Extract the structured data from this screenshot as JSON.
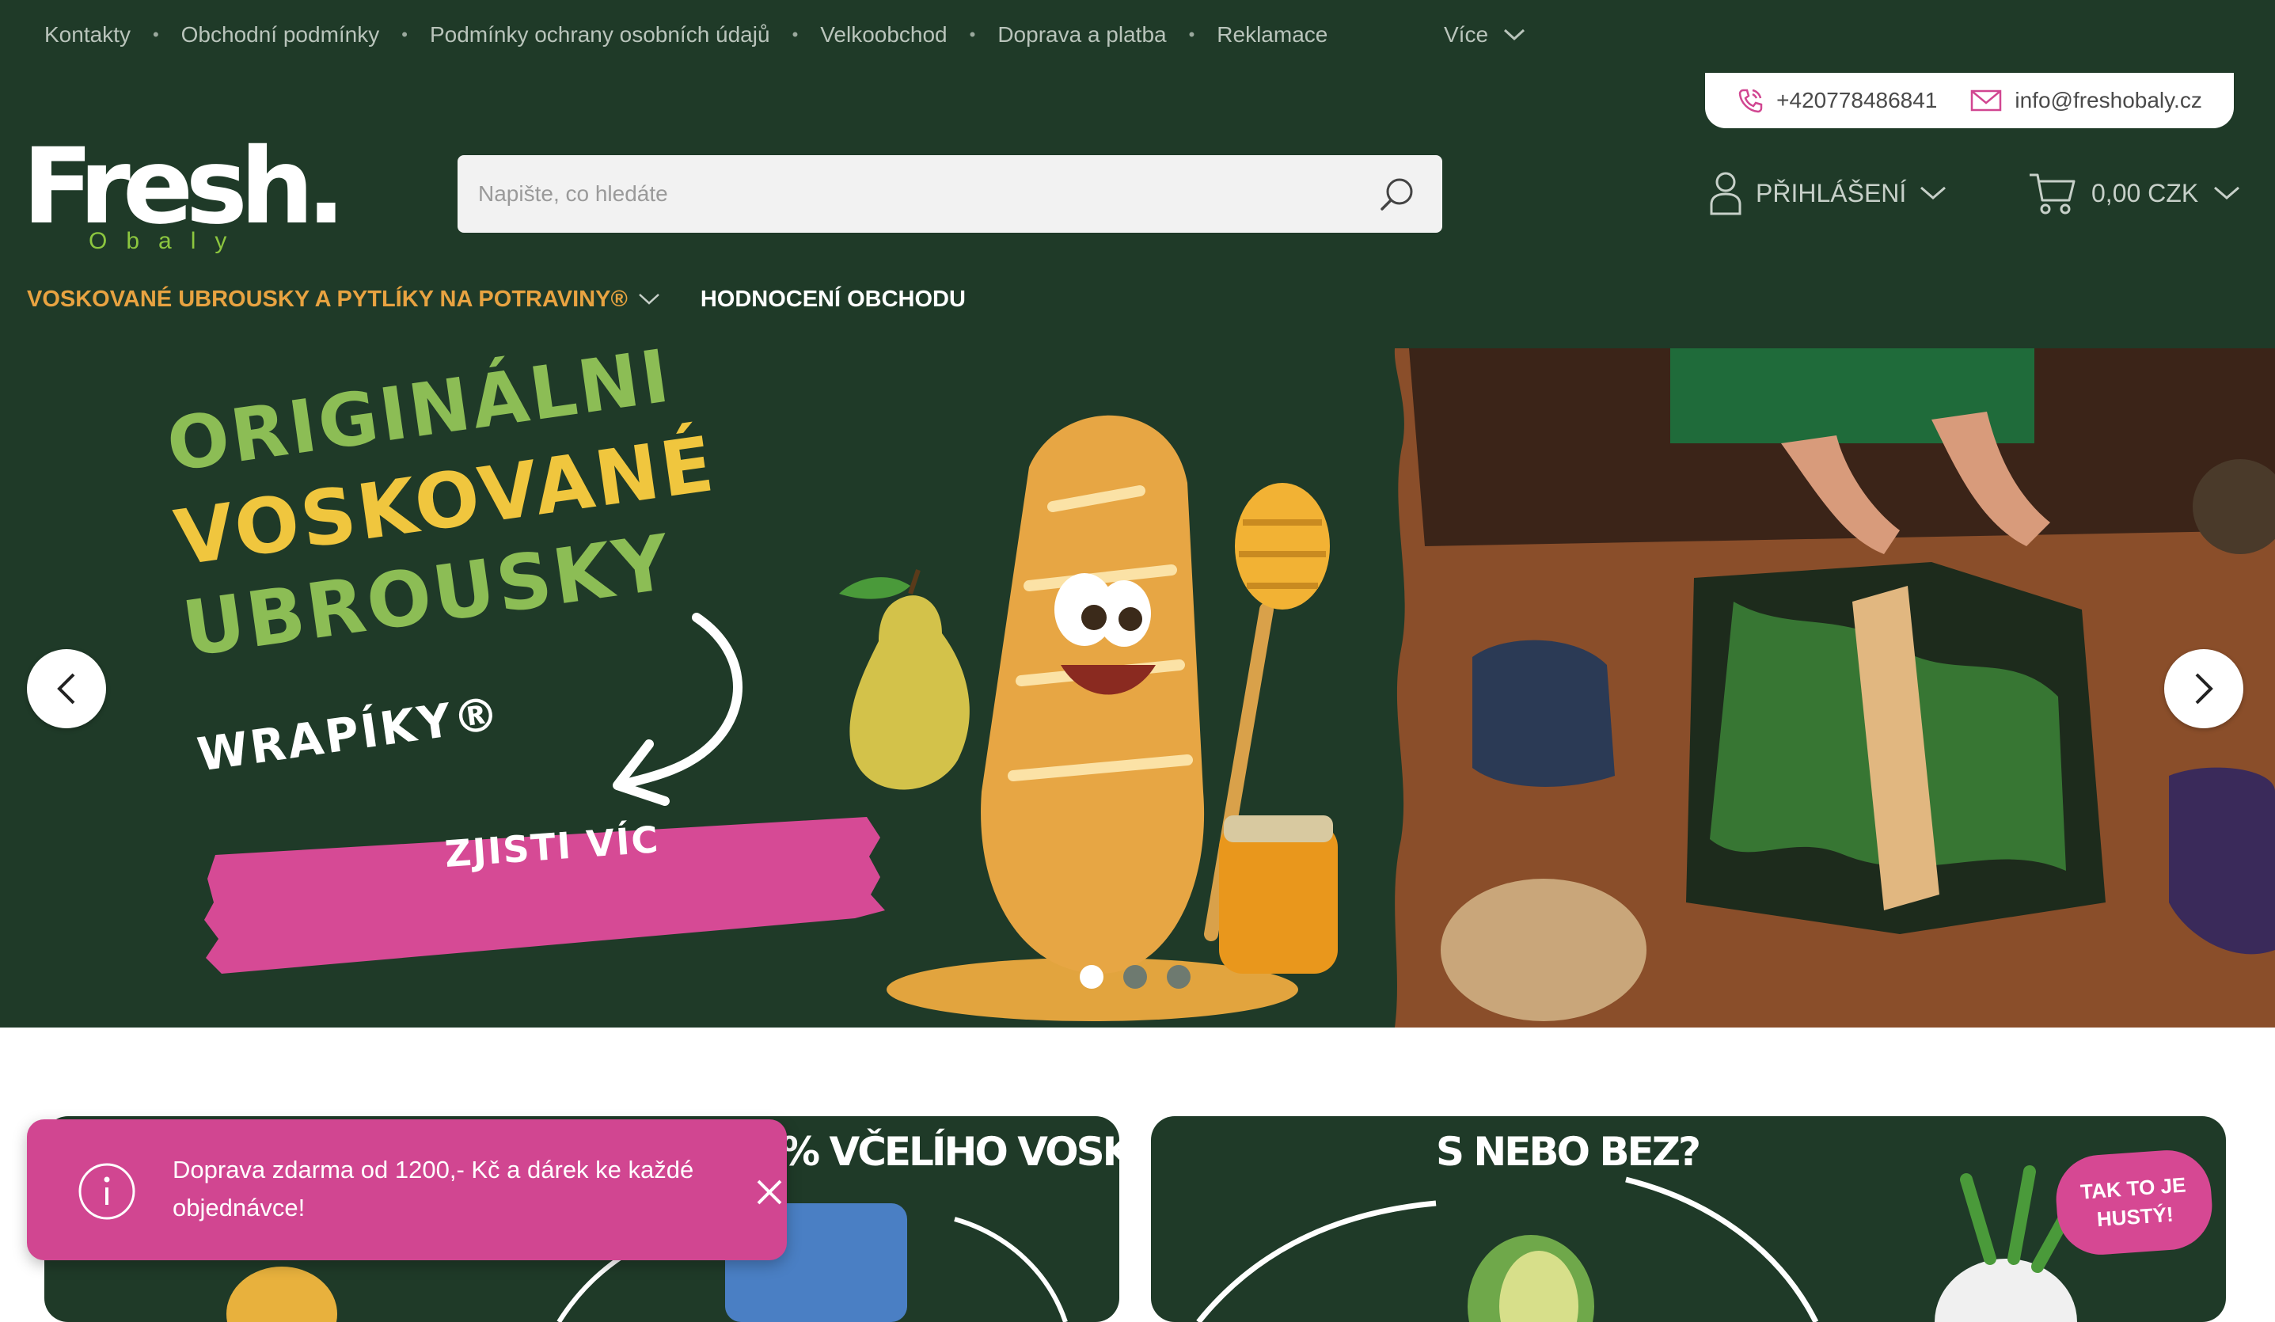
{
  "top_nav": {
    "items": [
      "Kontakty",
      "Obchodní podmínky",
      "Podmínky ochrany osobních údajů",
      "Velkoobchod",
      "Doprava a platba",
      "Reklamace"
    ],
    "more_label": "Více"
  },
  "contact": {
    "phone": "+420778486841",
    "email": "info@freshobaly.cz"
  },
  "logo": {
    "word": "Fresh.",
    "sub": "Obaly"
  },
  "search": {
    "placeholder": "Napište, co hledáte"
  },
  "account": {
    "login_label": "PŘIHLÁŠENÍ"
  },
  "cart": {
    "total": "0,00 CZK"
  },
  "main_nav": {
    "category_label": "VOSKOVANÉ UBROUSKY A PYTLÍKY NA POTRAVINY®",
    "reviews_label": "HODNOCENÍ OBCHODU"
  },
  "hero": {
    "line1": "ORIGINÁLNÍ",
    "line2": "VOSKOVANÉ",
    "line3": "UBROUSKY",
    "brand": "WRAPÍKY®",
    "cta": "ZJISTI VÍC",
    "slides": 3,
    "active_slide": 1
  },
  "promos": {
    "card1_title": "% VČELÍHO VOSKU",
    "card2_title": "S NEBO BEZ?",
    "badge_line1": "TAK TO JE",
    "badge_line2": "HUSTÝ!"
  },
  "toast": {
    "message": "Doprava zdarma od 1200,- Kč a dárek ke každé objednávce!"
  },
  "colors": {
    "brand_green": "#1f3a28",
    "accent_orange": "#e8a341",
    "accent_pink": "#d14691",
    "logo_green": "#8cc63f"
  }
}
